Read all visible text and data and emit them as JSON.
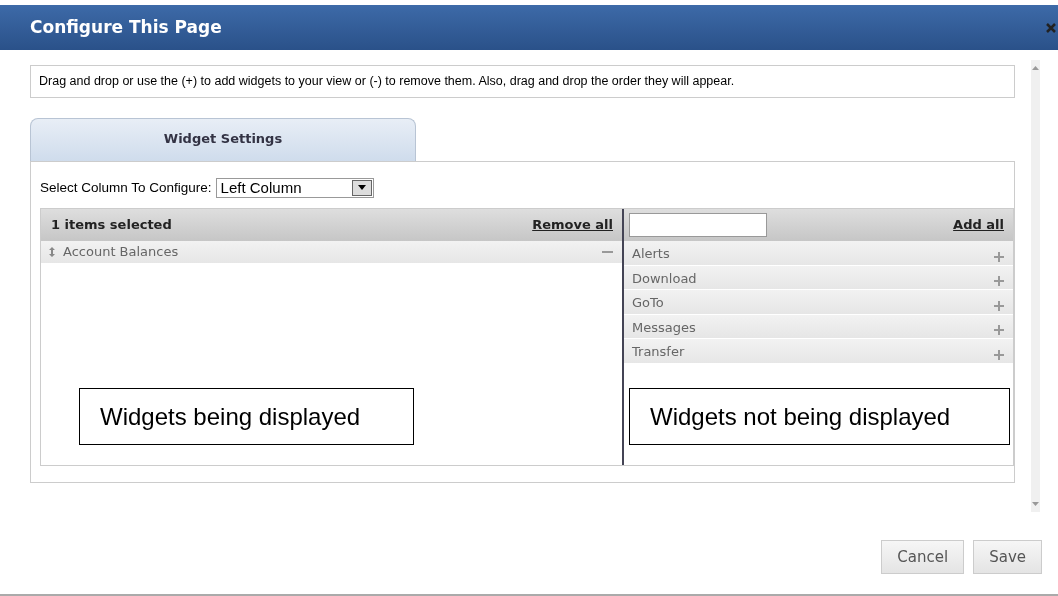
{
  "window": {
    "title": "Configure This Page"
  },
  "instructions": "Drag and drop or use the (+) to add widgets to your view or (-) to remove them. Also, drag and drop the order they will appear.",
  "tabs": [
    {
      "label": "Widget Settings",
      "selected": true
    }
  ],
  "column_select": {
    "label": "Select Column To Configure:",
    "value": "Left Column"
  },
  "displayed": {
    "header": "1 items selected",
    "action": "Remove all",
    "items": [
      {
        "label": "Account Balances"
      }
    ],
    "callout": "Widgets being displayed"
  },
  "available": {
    "action": "Add all",
    "items": [
      {
        "label": "Alerts"
      },
      {
        "label": "Download"
      },
      {
        "label": "GoTo"
      },
      {
        "label": "Messages"
      },
      {
        "label": "Transfer"
      }
    ],
    "callout": "Widgets not being displayed"
  },
  "buttons": [
    {
      "label": "Cancel"
    },
    {
      "label": "Save"
    }
  ]
}
